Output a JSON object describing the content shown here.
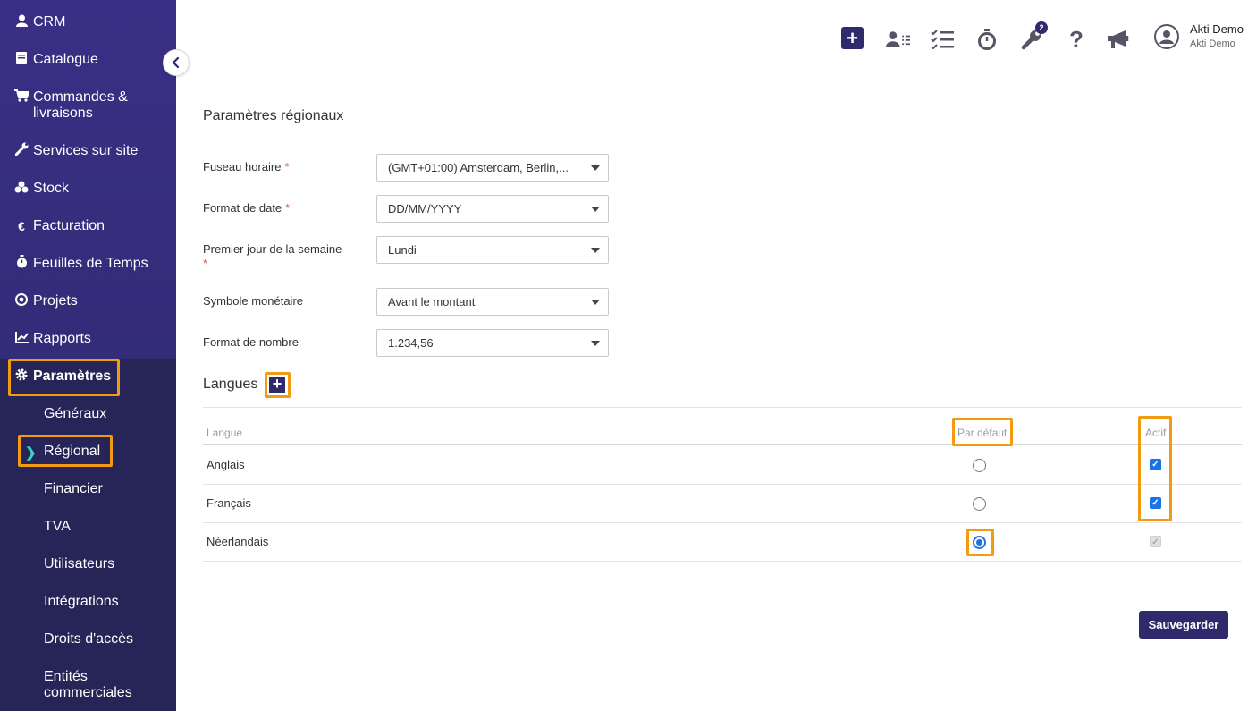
{
  "sidebar": {
    "items": [
      {
        "label": "CRM",
        "icon": "user-icon"
      },
      {
        "label": "Catalogue",
        "icon": "book-icon"
      },
      {
        "label": "Commandes &",
        "label2": "livraisons",
        "icon": "cart-icon"
      },
      {
        "label": "Services sur site",
        "icon": "wrench-icon"
      },
      {
        "label": "Stock",
        "icon": "boxes-icon"
      },
      {
        "label": "Facturation",
        "icon": "euro-icon"
      },
      {
        "label": "Feuilles de Temps",
        "icon": "stopwatch-icon"
      },
      {
        "label": "Projets",
        "icon": "target-icon"
      },
      {
        "label": "Rapports",
        "icon": "chart-icon"
      },
      {
        "label": "Paramètres",
        "icon": "gear-icon"
      }
    ],
    "sub_items": [
      {
        "label": "Généraux"
      },
      {
        "label": "Régional"
      },
      {
        "label": "Financier"
      },
      {
        "label": "TVA"
      },
      {
        "label": "Utilisateurs"
      },
      {
        "label": "Intégrations"
      },
      {
        "label": "Droits d'accès"
      },
      {
        "label": "Entités",
        "label2": "commerciales"
      }
    ]
  },
  "header": {
    "badge_count": "2",
    "user_name": "Akti Demo",
    "user_company": "Akti Demo"
  },
  "regional": {
    "title": "Paramètres régionaux",
    "fields": [
      {
        "label": "Fuseau horaire",
        "value": "(GMT+01:00) Amsterdam, Berlin,..."
      },
      {
        "label": "Format de date",
        "value": "DD/MM/YYYY"
      },
      {
        "label": "Premier jour de la semaine",
        "value": "Lundi"
      },
      {
        "label": "Symbole monétaire",
        "value": "Avant le montant"
      },
      {
        "label": "Format de nombre",
        "value": "1.234,56"
      }
    ],
    "required_mark": "*"
  },
  "languages": {
    "title": "Langues",
    "columns": {
      "lang": "Langue",
      "default": "Par défaut",
      "active": "Actif"
    },
    "rows": [
      {
        "name": "Anglais",
        "default": false,
        "active": true
      },
      {
        "name": "Français",
        "default": false,
        "active": true
      },
      {
        "name": "Néerlandais",
        "default": true,
        "active": true
      }
    ]
  },
  "save_label": "Sauvegarder",
  "colors": {
    "brand": "#2f2a6b",
    "highlight": "#f29a12",
    "accent": "#3dd1c4"
  }
}
